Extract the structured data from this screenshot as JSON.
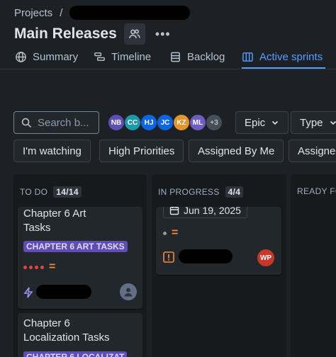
{
  "breadcrumb": {
    "root": "Projects",
    "separator": "/"
  },
  "header": {
    "title": "Main Releases"
  },
  "tabs": [
    {
      "label": "Summary",
      "icon": "globe-icon"
    },
    {
      "label": "Timeline",
      "icon": "timeline-icon"
    },
    {
      "label": "Backlog",
      "icon": "backlog-icon"
    },
    {
      "label": "Active sprints",
      "icon": "board-icon",
      "active": true
    }
  ],
  "filters": {
    "search_placeholder": "Search b...",
    "avatars": [
      {
        "initials": "NB",
        "color": "#5e4db2"
      },
      {
        "initials": "CC",
        "color": "#1d9aaa"
      },
      {
        "initials": "HJ",
        "color": "#0c66e4"
      },
      {
        "initials": "JC",
        "color": "#0c66e4"
      },
      {
        "initials": "KZ",
        "color": "#e2942f"
      },
      {
        "initials": "ML",
        "color": "#6e5dc6"
      }
    ],
    "more_avatars": "+3",
    "epic_label": "Epic",
    "type_label": "Type",
    "quick_filters": [
      "I'm watching",
      "High Priorities",
      "Assigned By Me",
      "Assigne"
    ]
  },
  "columns": [
    {
      "name": "TO DO",
      "count": "14/14"
    },
    {
      "name": "IN PROGRESS",
      "count": "4/4"
    },
    {
      "name": "READY FO",
      "count": ""
    }
  ],
  "cards": {
    "todo_1": {
      "title_line1": "Chapter 6 Art",
      "title_line2": "Tasks",
      "epic": "CHAPTER 6 ART TASKS",
      "priority": "="
    },
    "todo_2": {
      "title_line1": "Chapter 6",
      "title_line2": "Localization Tasks",
      "epic": "CHAPTER 6 LOCALIZAT"
    },
    "inprogress_1": {
      "date": "Jun 19, 2025",
      "priority": "=",
      "assignee_initials": "WP"
    }
  },
  "colors": {
    "accent": "#579dff",
    "epic_purple": "#5e4db2",
    "priority_orange": "#f38a3f",
    "priority_red": "#e2483d",
    "assignee_wp": "#c9372c"
  }
}
